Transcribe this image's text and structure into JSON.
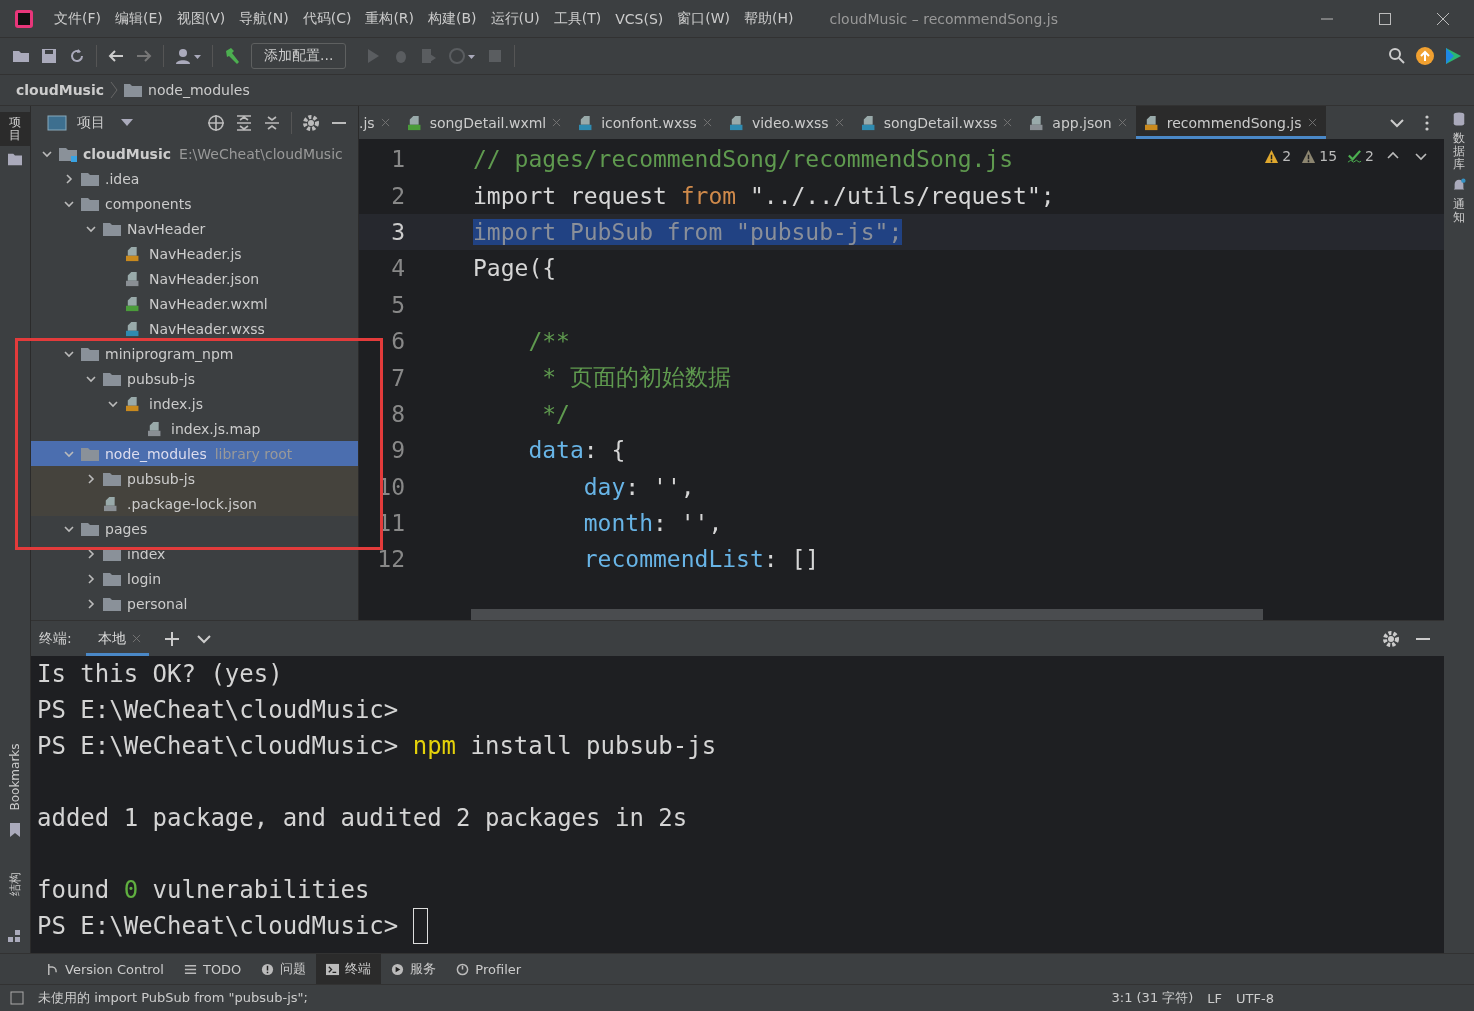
{
  "window": {
    "title": "cloudMusic – recommendSong.js",
    "menu": [
      "文件(F)",
      "编辑(E)",
      "视图(V)",
      "导航(N)",
      "代码(C)",
      "重构(R)",
      "构建(B)",
      "运行(U)",
      "工具(T)",
      "VCS(S)",
      "窗口(W)",
      "帮助(H)"
    ]
  },
  "toolbar": {
    "run_config": "添加配置..."
  },
  "breadcrumb": [
    "cloudMusic",
    "node_modules"
  ],
  "left_strip": {
    "top": [
      "项目"
    ],
    "bottom": [
      "Bookmarks",
      "结构"
    ]
  },
  "right_strip": [
    "数据库",
    "通知"
  ],
  "project": {
    "title": "项目",
    "tree": [
      {
        "label": "cloudMusic",
        "kind": "module",
        "hint": "E:\\WeCheat\\cloudMusic",
        "expanded": true,
        "selected": false,
        "children": [
          {
            "label": ".idea",
            "kind": "folder",
            "expanded": false,
            "selected": false
          },
          {
            "label": "components",
            "kind": "folder",
            "expanded": true,
            "selected": false,
            "children": [
              {
                "label": "NavHeader",
                "kind": "folder",
                "expanded": true,
                "selected": false,
                "children": [
                  {
                    "label": "NavHeader.js",
                    "kind": "js",
                    "selected": false
                  },
                  {
                    "label": "NavHeader.json",
                    "kind": "json",
                    "selected": false
                  },
                  {
                    "label": "NavHeader.wxml",
                    "kind": "wxml",
                    "selected": false
                  },
                  {
                    "label": "NavHeader.wxss",
                    "kind": "wxss",
                    "selected": false
                  }
                ]
              }
            ]
          },
          {
            "label": "miniprogram_npm",
            "kind": "folder",
            "expanded": true,
            "selected": false,
            "children": [
              {
                "label": "pubsub-js",
                "kind": "folder",
                "expanded": true,
                "selected": false,
                "children": [
                  {
                    "label": "index.js",
                    "kind": "js",
                    "expanded": true,
                    "selected": false,
                    "children": [
                      {
                        "label": "index.js.map",
                        "kind": "json",
                        "selected": false
                      }
                    ]
                  }
                ]
              }
            ]
          },
          {
            "label": "node_modules",
            "kind": "folder",
            "hint": "library root",
            "library": true,
            "expanded": true,
            "selected": true,
            "children": [
              {
                "label": "pubsub-js",
                "kind": "folder",
                "expanded": false,
                "selected": false
              },
              {
                "label": ".package-lock.json",
                "kind": "json",
                "selected": false
              }
            ]
          },
          {
            "label": "pages",
            "kind": "folder",
            "expanded": true,
            "selected": false,
            "children": [
              {
                "label": "index",
                "kind": "folder",
                "expanded": false,
                "selected": false
              },
              {
                "label": "login",
                "kind": "folder",
                "expanded": false,
                "selected": false
              },
              {
                "label": "personal",
                "kind": "folder",
                "expanded": false,
                "selected": false
              }
            ]
          }
        ]
      }
    ]
  },
  "editor": {
    "tabs": [
      {
        "label": ".js",
        "kind": "js",
        "selected": false
      },
      {
        "label": "songDetail.wxml",
        "kind": "wxml",
        "selected": false
      },
      {
        "label": "iconfont.wxss",
        "kind": "wxss",
        "selected": false
      },
      {
        "label": "video.wxss",
        "kind": "wxss",
        "selected": false
      },
      {
        "label": "songDetail.wxss",
        "kind": "wxss",
        "selected": false
      },
      {
        "label": "app.json",
        "kind": "json",
        "selected": false
      },
      {
        "label": "recommendSong.js",
        "kind": "js",
        "selected": true
      }
    ],
    "inspections": [
      {
        "kind": "warning",
        "count": "2"
      },
      {
        "kind": "weak",
        "count": "15"
      },
      {
        "kind": "typo",
        "count": "2"
      }
    ],
    "lines": [
      {
        "number": "1",
        "selected": false,
        "tokens": [
          {
            "t": "// pages/recommendSong/recommendSong.js",
            "kind": "comment"
          }
        ]
      },
      {
        "number": "2",
        "selected": false,
        "tokens": [
          {
            "t": "import ",
            "kind": "plain"
          },
          {
            "t": "request ",
            "kind": "plain"
          },
          {
            "t": "from ",
            "kind": "keyword"
          },
          {
            "t": "\"../../utils/request\"",
            "kind": "plain"
          },
          {
            "t": ";",
            "kind": "plain"
          }
        ]
      },
      {
        "number": "3",
        "selected": true,
        "tokens": [
          {
            "t": "import PubSub from \"pubsub-js\";",
            "kind": "unused"
          }
        ]
      },
      {
        "number": "4",
        "selected": false,
        "tokens": [
          {
            "t": "Page",
            "kind": "plain"
          },
          {
            "t": "({",
            "kind": "plain"
          }
        ]
      },
      {
        "number": "5",
        "selected": false
      },
      {
        "number": "6",
        "selected": false,
        "tokens": [
          {
            "t": "    /**",
            "kind": "doc"
          }
        ]
      },
      {
        "number": "7",
        "selected": false,
        "tokens": [
          {
            "t": "     * 页面的初始数据",
            "kind": "doc"
          }
        ]
      },
      {
        "number": "8",
        "selected": false,
        "tokens": [
          {
            "t": "     */",
            "kind": "doc"
          }
        ]
      },
      {
        "number": "9",
        "selected": false,
        "tokens": [
          {
            "t": "    data",
            "kind": "prop"
          },
          {
            "t": ": {",
            "kind": "plain"
          }
        ]
      },
      {
        "number": "10",
        "selected": false,
        "tokens": [
          {
            "t": "        day",
            "kind": "prop"
          },
          {
            "t": ": ",
            "kind": "plain"
          },
          {
            "t": "''",
            "kind": "string"
          },
          {
            "t": ",",
            "kind": "plain"
          }
        ]
      },
      {
        "number": "11",
        "selected": false,
        "tokens": [
          {
            "t": "        month",
            "kind": "prop"
          },
          {
            "t": ": ",
            "kind": "plain"
          },
          {
            "t": "''",
            "kind": "string"
          },
          {
            "t": ",",
            "kind": "plain"
          }
        ]
      },
      {
        "number": "12",
        "selected": false,
        "tokens": [
          {
            "t": "        recommendList",
            "kind": "prop"
          },
          {
            "t": ": []",
            "kind": "plain"
          }
        ]
      }
    ]
  },
  "terminal": {
    "title": "终端:",
    "tabs": [
      {
        "label": "本地",
        "selected": true
      }
    ],
    "lines": [
      {
        "kind": "text",
        "cursor": false,
        "segments": [
          {
            "t": "Is this OK? (yes)",
            "kind": "plain"
          }
        ]
      },
      {
        "kind": "text",
        "cursor": false,
        "segments": [
          {
            "t": "PS E:\\WeCheat\\cloudMusic>",
            "kind": "plain"
          }
        ]
      },
      {
        "kind": "text",
        "cursor": false,
        "segments": [
          {
            "t": "PS E:\\WeCheat\\cloudMusic> ",
            "kind": "plain"
          },
          {
            "t": "npm",
            "kind": "command"
          },
          {
            "t": " install pubsub-js",
            "kind": "plain"
          }
        ]
      },
      {
        "kind": "blank"
      },
      {
        "kind": "text",
        "cursor": false,
        "segments": [
          {
            "t": "added 1 package, and audited 2 packages in 2s",
            "kind": "plain"
          }
        ]
      },
      {
        "kind": "blank"
      },
      {
        "kind": "text",
        "cursor": false,
        "segments": [
          {
            "t": "found ",
            "kind": "plain"
          },
          {
            "t": "0",
            "kind": "number"
          },
          {
            "t": " vulnerabilities",
            "kind": "plain"
          }
        ]
      },
      {
        "kind": "text",
        "cursor": true,
        "segments": [
          {
            "t": "PS E:\\WeCheat\\cloudMusic> ",
            "kind": "plain"
          }
        ]
      }
    ]
  },
  "tool_tabs": [
    {
      "label": "Version Control",
      "kind": "vcs",
      "selected": false
    },
    {
      "label": "TODO",
      "kind": "todo",
      "selected": false
    },
    {
      "label": "问题",
      "kind": "problems",
      "selected": false
    },
    {
      "label": "终端",
      "kind": "terminal",
      "selected": true
    },
    {
      "label": "服务",
      "kind": "services",
      "selected": false
    },
    {
      "label": "Profiler",
      "kind": "profiler",
      "selected": false
    }
  ],
  "status_bar": {
    "message": "未使用的 import PubSub from \"pubsub-js\";",
    "position": "3:1 (31 字符)",
    "line_ending": "LF",
    "encoding": "UTF-8"
  }
}
